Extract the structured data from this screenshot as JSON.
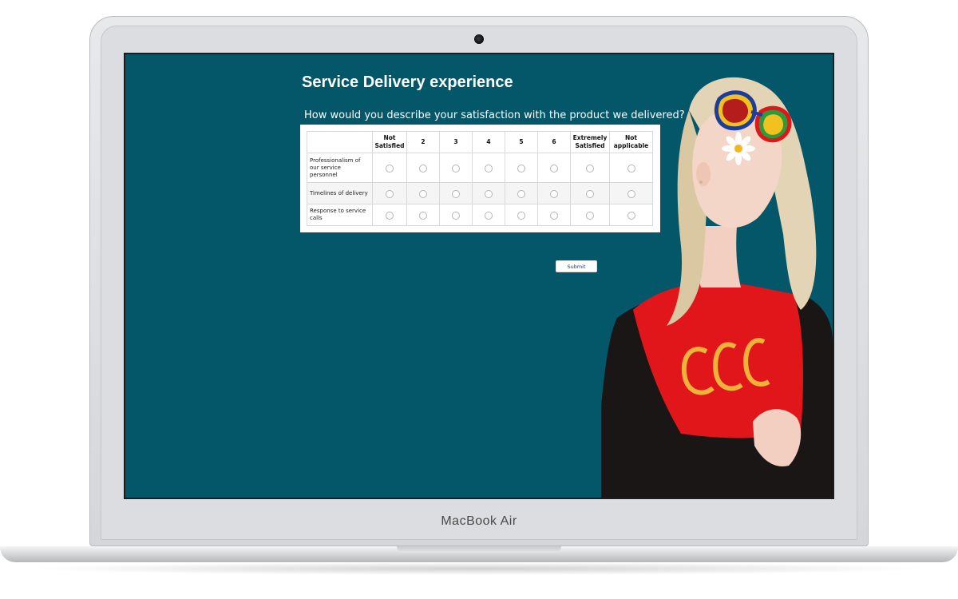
{
  "device": {
    "brand": "MacBook Air"
  },
  "survey": {
    "title": "Service Delivery experience",
    "question": "How would you describe your satisfaction with the product we delivered?",
    "columns": [
      "Not Satisfied",
      "2",
      "3",
      "4",
      "5",
      "6",
      "Extremely Satisfied",
      "Not applicable"
    ],
    "rows": [
      "Professionalism of our service personnel",
      "Timelines of delivery",
      "Response to service calls"
    ],
    "submit_label": "Submit"
  },
  "colors": {
    "screen_background": "#035769",
    "shirt": "#e0161b",
    "hair": "#e2d4b4"
  }
}
